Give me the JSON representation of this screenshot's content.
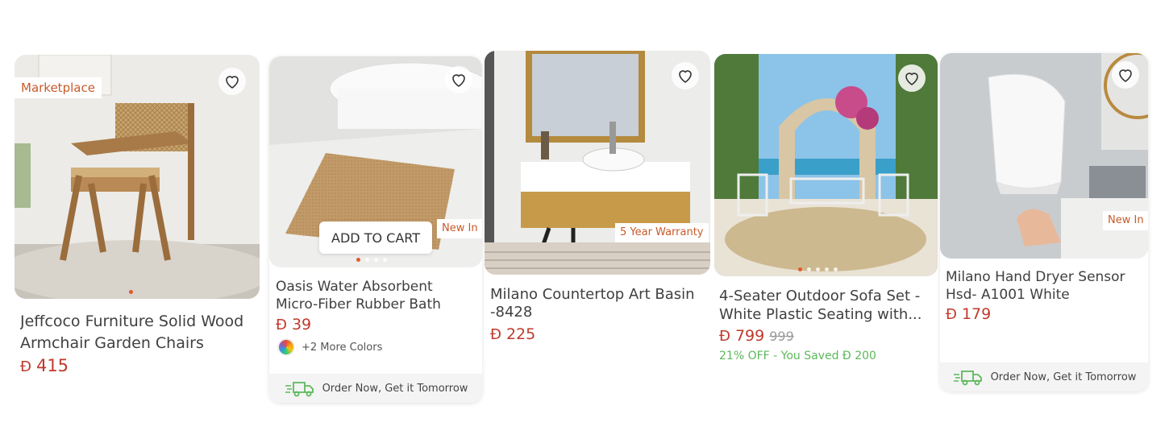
{
  "products": [
    {
      "badge": "Marketplace",
      "title": "Jeffcoco Furniture Solid Wood Armchair Garden Chairs Dinin...",
      "currency": "Ð",
      "price": "415"
    },
    {
      "badge": "New In",
      "add_to_cart": "ADD TO CART",
      "title": "Oasis Water Absorbent Micro-Fiber Rubber Bath Mat...",
      "currency": "Ð",
      "price": "39",
      "more_colors": "+2 More Colors",
      "delivery": "Order Now, Get it Tomorrow"
    },
    {
      "badge": "5 Year Warranty",
      "title": "Milano Countertop Art Basin -8428",
      "currency": "Ð",
      "price": "225"
    },
    {
      "title": "4-Seater Outdoor Sofa Set - White Plastic Seating with...",
      "currency": "Ð",
      "price": "799",
      "old_price": "999",
      "savings": "21% OFF - You Saved Ð 200"
    },
    {
      "badge": "New In",
      "title": "Milano Hand Dryer Sensor Hsd- A1001 White",
      "currency": "Ð",
      "price": "179",
      "delivery": "Order Now, Get it Tomorrow"
    }
  ],
  "colors": {
    "price": "#c0392b",
    "badge": "#c85a2a",
    "savings": "#5cb85c",
    "delivery_icon": "#5cb85c"
  },
  "icons": {
    "wishlist": "heart-outline-icon",
    "delivery": "truck-icon",
    "color_swatch": "color-wheel-icon"
  }
}
